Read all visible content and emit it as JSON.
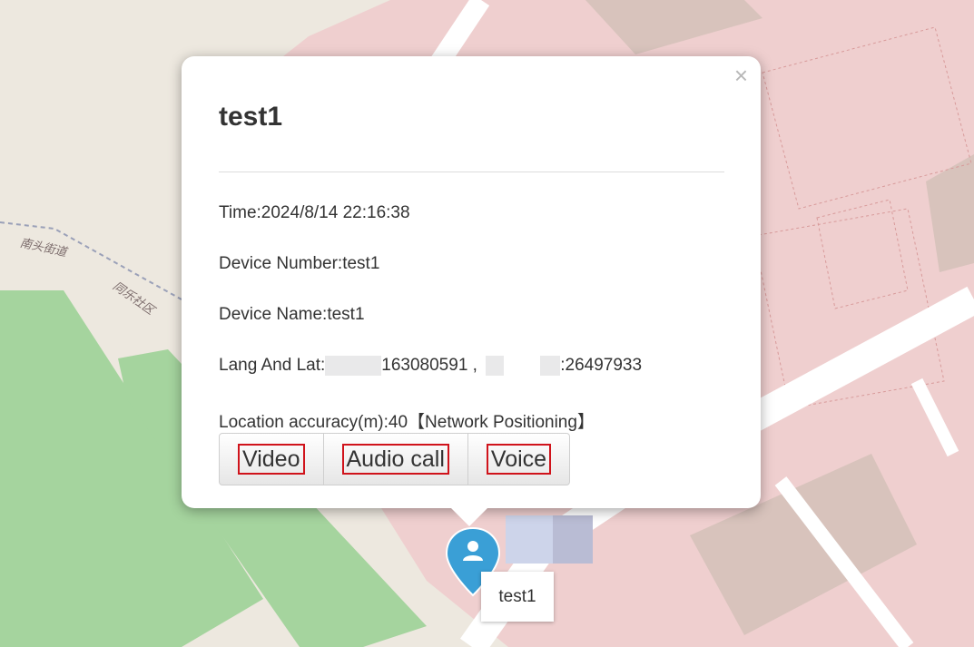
{
  "map": {
    "labels": {
      "street": "南头街道",
      "community": "同乐社区"
    }
  },
  "popup": {
    "title": "test1",
    "close_label": "×",
    "time": "Time:2024/8/14 22:16:38",
    "device_number": "Device Number:test1",
    "device_name": "Device Name:test1",
    "lang_lat": {
      "label": "Lang And Lat:",
      "lng_visible": "163080591",
      "separator": " ,",
      "lat_visible": ":26497933"
    },
    "accuracy": "Location accuracy(m):40【Network Positioning】",
    "buttons": {
      "video": "Video",
      "audio_call": "Audio call",
      "voice": "Voice"
    }
  },
  "marker": {
    "label": "test1",
    "color": "#3a9fd6"
  },
  "colors": {
    "building_fill": "#efcfcf",
    "park_fill": "#a5d49e",
    "road_fill": "#ffffff"
  }
}
